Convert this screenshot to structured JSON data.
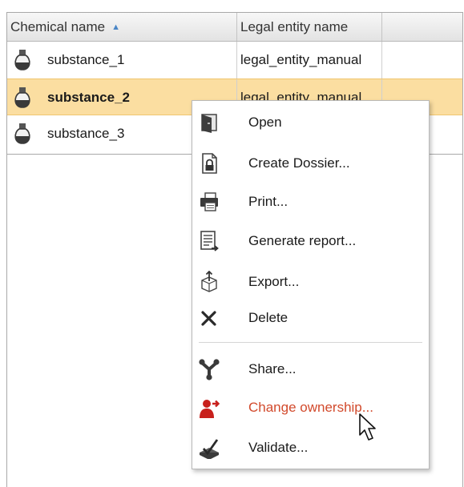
{
  "grid": {
    "columns": [
      {
        "label": "Chemical name",
        "sort": "ascending"
      },
      {
        "label": "Legal entity name"
      }
    ],
    "rows": [
      {
        "name": "substance_1",
        "entity": "legal_entity_manual",
        "selected": false
      },
      {
        "name": "substance_2",
        "entity": "legal_entity_manual",
        "selected": true
      },
      {
        "name": "substance_3",
        "entity": "",
        "selected": false
      }
    ]
  },
  "context_menu": {
    "items": [
      {
        "label": "Open",
        "icon": "open-icon"
      },
      {
        "label": "Create Dossier...",
        "icon": "dossier-icon"
      },
      {
        "label": "Print...",
        "icon": "printer-icon"
      },
      {
        "label": "Generate report...",
        "icon": "report-icon"
      },
      {
        "label": "Export...",
        "icon": "export-icon"
      },
      {
        "label": "Delete",
        "icon": "delete-icon"
      },
      {
        "label": "Share...",
        "icon": "share-icon"
      },
      {
        "label": "Change ownership...",
        "icon": "change-ownership-icon",
        "hovered": true
      },
      {
        "label": "Validate...",
        "icon": "validate-icon"
      }
    ]
  },
  "colors": {
    "selected_row": "#fbdea1",
    "hover_text": "#d24a2c",
    "sort_arrow": "#4a86c6"
  }
}
